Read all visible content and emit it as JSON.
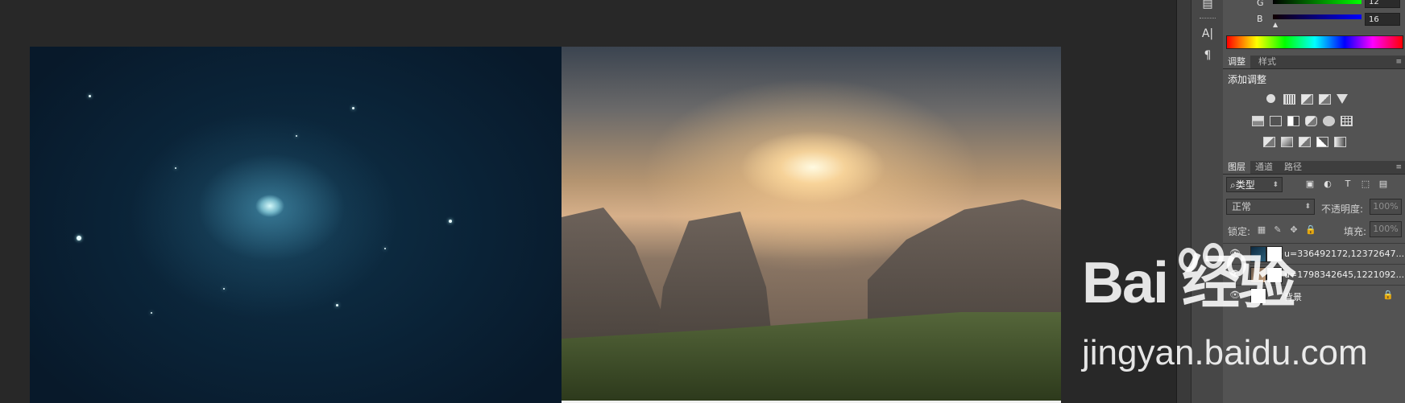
{
  "toolstrip": {
    "type_tool_label": "A|",
    "paragraph_label": "¶"
  },
  "color_panel": {
    "rows": [
      {
        "label": "G",
        "value": "12"
      },
      {
        "label": "B",
        "value": "16"
      }
    ]
  },
  "adjust_panel": {
    "tabs": [
      "调整",
      "样式"
    ],
    "title": "添加调整"
  },
  "layers_panel": {
    "tabs": [
      "图层",
      "通道",
      "路径"
    ],
    "filter": {
      "label": "类型"
    },
    "blend_mode": "正常",
    "opacity_label": "不透明度:",
    "opacity_value": "100%",
    "lock_label": "锁定:",
    "fill_label": "填充:",
    "fill_value": "100%",
    "layers": [
      {
        "name": "u=336492172,12372647..."
      },
      {
        "name": "u=1798342645,1221092..."
      },
      {
        "name": "背景"
      }
    ]
  },
  "watermark": {
    "logo": "Bai  经验",
    "url": "jingyan.baidu.com"
  },
  "colors": {
    "accent": "#535353",
    "panel_dark": "#3e3e3e",
    "canvas_bg": "#282828"
  }
}
